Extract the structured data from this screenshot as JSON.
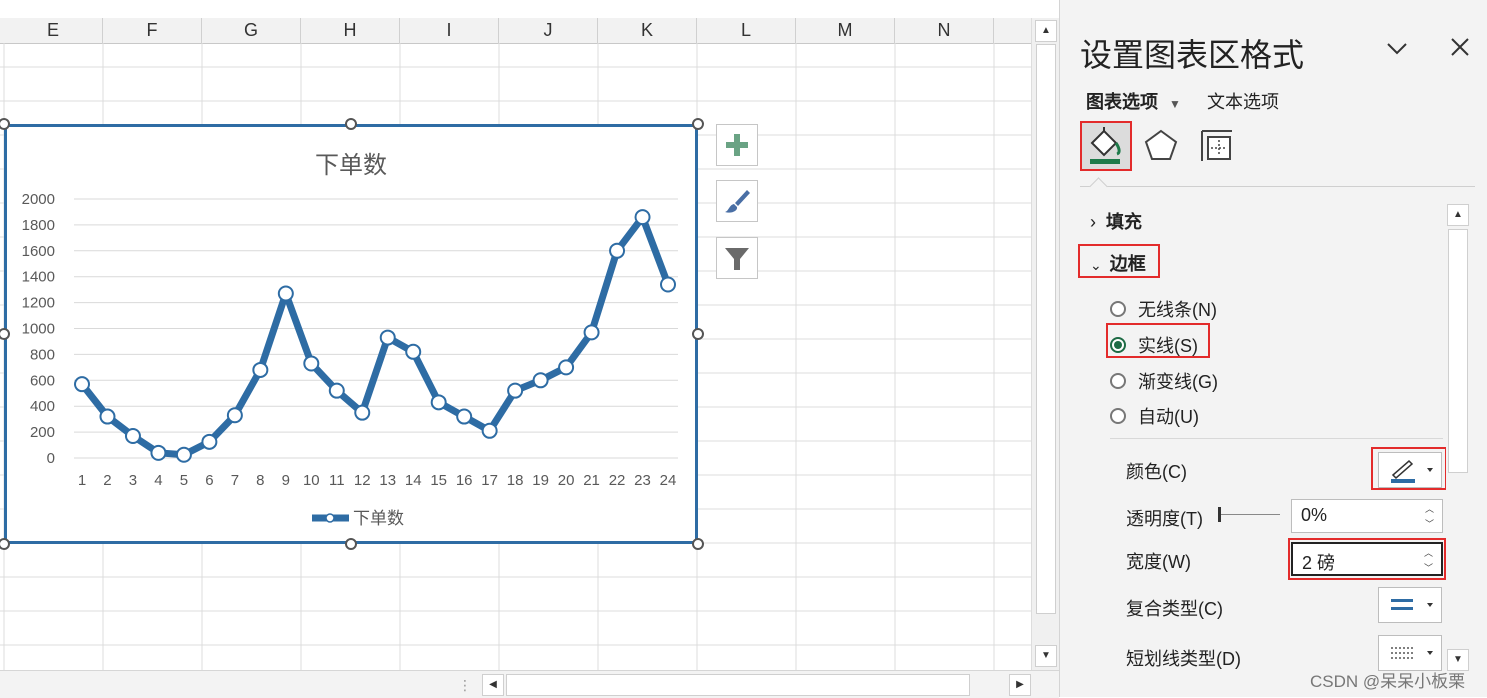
{
  "sheet": {
    "columns": [
      "E",
      "F",
      "G",
      "H",
      "I",
      "J",
      "K",
      "L",
      "M",
      "N"
    ]
  },
  "chart": {
    "tools": [
      {
        "name": "add-element",
        "icon": "plus-icon"
      },
      {
        "name": "chart-styles",
        "icon": "brush-icon"
      },
      {
        "name": "chart-filter",
        "icon": "funnel-icon"
      }
    ]
  },
  "chart_data": {
    "type": "line",
    "title": "下单数",
    "categories": [
      "1",
      "2",
      "3",
      "4",
      "5",
      "6",
      "7",
      "8",
      "9",
      "10",
      "11",
      "12",
      "13",
      "14",
      "15",
      "16",
      "17",
      "18",
      "19",
      "20",
      "21",
      "22",
      "23",
      "24"
    ],
    "series": [
      {
        "name": "下单数",
        "values": [
          570,
          320,
          170,
          40,
          25,
          125,
          330,
          680,
          1270,
          730,
          520,
          350,
          930,
          820,
          430,
          320,
          210,
          520,
          600,
          700,
          970,
          1600,
          1860,
          1340
        ]
      }
    ],
    "yticks": [
      "0",
      "200",
      "400",
      "600",
      "800",
      "1000",
      "1200",
      "1400",
      "1600",
      "1800",
      "2000"
    ],
    "ylim": [
      0,
      2000
    ],
    "grid": true,
    "legend": "bottom",
    "line_color": "#2e6ca4"
  },
  "pane": {
    "title": "设置图表区格式",
    "tabs": {
      "chart_options": "图表选项",
      "text_options": "文本选项"
    },
    "sections": {
      "fill": "填充",
      "border": "边框"
    },
    "radios": [
      {
        "label": "无线条(N)",
        "checked": false
      },
      {
        "label": "实线(S)",
        "checked": true
      },
      {
        "label": "渐变线(G)",
        "checked": false
      },
      {
        "label": "自动(U)",
        "checked": false
      }
    ],
    "props": {
      "color": "颜色(C)",
      "transparency": "透明度(T)",
      "transparency_value": "0%",
      "width": "宽度(W)",
      "width_value": "2 磅",
      "compound": "复合类型(C)",
      "dash": "短划线类型(D)"
    }
  },
  "watermark": "CSDN @呆呆小板栗"
}
